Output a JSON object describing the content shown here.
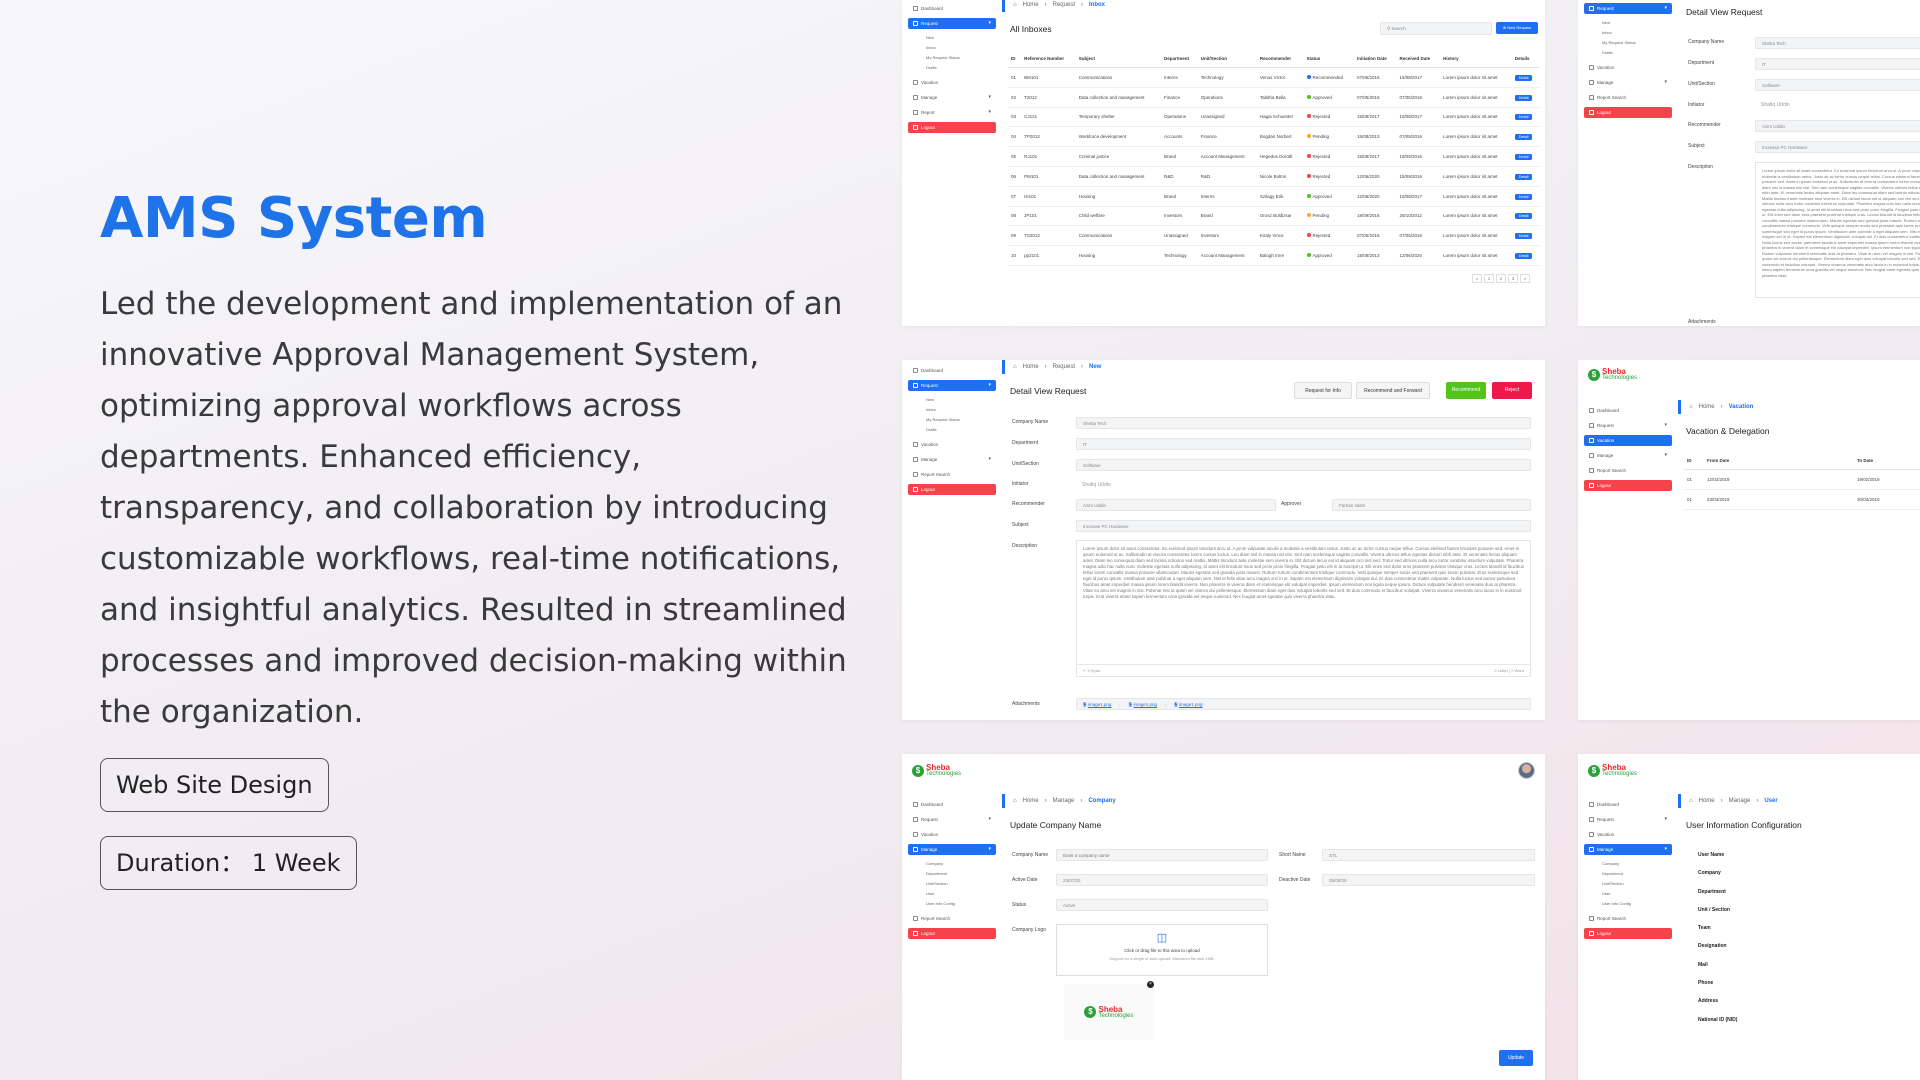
{
  "hero": {
    "title": "AMS System",
    "description": "Led the development and implementation of an innovative Approval Management System, optimizing approval workflows across departments. Enhanced efficiency, transparency, and collaboration by introducing customizable workflows, real-time notifications, and insightful analytics. Resulted in streamlined processes and improved decision-making within the organization.",
    "tag1": "Web Site Design",
    "tag2": "Duration： 1 Week"
  },
  "brand": {
    "logo_letter": "$",
    "line1": "Sheba",
    "line2": "Technologies",
    "green": "#2aa23a",
    "red": "#e62b2b"
  },
  "colors": {
    "accent": "#1e73e8",
    "primary": "#1e6ff1",
    "danger": "#f5424b",
    "success": "#52c41a"
  },
  "sidebar": {
    "dashboard": "Dashboard",
    "request": "Request",
    "vacation": "Vacation",
    "manage": "Manage",
    "report": "Report",
    "report_search": "Report Search",
    "logout": "Logout",
    "request_sub": [
      "New",
      "Inbox",
      "My Request Status",
      "Drafts"
    ],
    "manage_sub": [
      "Company",
      "Department",
      "Unit/Section",
      "User",
      "User Info Config"
    ]
  },
  "crumbs": {
    "home": "Home",
    "request": "Request",
    "manage": "Manage",
    "inbox": "Inbox",
    "new": "New",
    "vacation": "Vacation",
    "company": "Company",
    "user": "User"
  },
  "inbox": {
    "title": "All Inboxes",
    "search_placeholder": "Search",
    "new_request": "New Request",
    "headers": [
      "ID",
      "Reference Number",
      "Subject",
      "Department",
      "Unit/Section",
      "Recommender",
      "Status",
      "Initiation Date",
      "Received Date",
      "History",
      "Details"
    ],
    "rows": [
      {
        "id": "01",
        "ref": "BM101",
        "subject": "Communications",
        "dept": "Interns",
        "unit": "Technology",
        "rec": "Venus Victor",
        "status": "Recommended",
        "sc": "#1e6ff1",
        "init": "07/05/2016",
        "recv": "15/08/2017",
        "hist": "Lorem ipsum dolor sit amet",
        "btn": "Detail"
      },
      {
        "id": "02",
        "ref": "T2012",
        "subject": "Data collection and management",
        "dept": "Finance",
        "unit": "Operations",
        "rec": "Tabitha Bella",
        "status": "Approved",
        "sc": "#52c41a",
        "init": "07/05/2016",
        "recv": "07/05/2016",
        "hist": "Lorem ipsum dolor sit amet",
        "btn": "Detail"
      },
      {
        "id": "03",
        "ref": "CJ121",
        "subject": "Temporary shelter",
        "dept": "Operations",
        "unit": "Unassigned",
        "rec": "Hagai Schuester",
        "status": "Rejected",
        "sc": "#f5424b",
        "init": "15/08/2017",
        "recv": "15/08/2017",
        "hist": "Lorem ipsum dolor sit amet",
        "btn": "Detail"
      },
      {
        "id": "04",
        "ref": "TP2012",
        "subject": "Workforce development",
        "dept": "Accounts",
        "unit": "Finance",
        "rec": "Bogdan Norbert",
        "status": "Pending",
        "sc": "#faad14",
        "init": "15/08/2013",
        "recv": "07/05/2016",
        "hist": "Lorem ipsum dolor sit amet",
        "btn": "Detail"
      },
      {
        "id": "05",
        "ref": "RJ101",
        "subject": "Criminal justice",
        "dept": "Brand",
        "unit": "Account Management",
        "rec": "Hegedus Dorottl",
        "status": "Rejected",
        "sc": "#f5424b",
        "init": "15/08/2017",
        "recv": "18/09/2016",
        "hist": "Lorem ipsum dolor sit amet",
        "btn": "Detail"
      },
      {
        "id": "06",
        "ref": "PM101",
        "subject": "Data collection and management",
        "dept": "R&D",
        "unit": "R&D",
        "rec": "Nicole Bolton",
        "status": "Rejected",
        "sc": "#f5424b",
        "init": "12/06/2020",
        "recv": "18/09/2016",
        "hist": "Lorem ipsum dolor sit amet",
        "btn": "Detail"
      },
      {
        "id": "07",
        "ref": "HI101",
        "subject": "Housing",
        "dept": "Brand",
        "unit": "Interns",
        "rec": "Szilagy Erik",
        "status": "Approved",
        "sc": "#52c41a",
        "init": "12/06/2020",
        "recv": "15/08/2017",
        "hist": "Lorem ipsum dolor sit amet",
        "btn": "Detail"
      },
      {
        "id": "08",
        "ref": "JP101",
        "subject": "Child welfare",
        "dept": "Investors",
        "unit": "Brand",
        "rec": "Orosz Boldizsar",
        "status": "Pending",
        "sc": "#faad14",
        "init": "18/09/2016",
        "recv": "28/10/2012",
        "hist": "Lorem ipsum dolor sit amet",
        "btn": "Detail"
      },
      {
        "id": "09",
        "ref": "TS2012",
        "subject": "Communications",
        "dept": "Unassigned",
        "unit": "Investors",
        "rec": "Kiraly Vince",
        "status": "Rejected",
        "sc": "#f5424b",
        "init": "07/05/2016",
        "recv": "07/05/2016",
        "hist": "Lorem ipsum dolor sit amet",
        "btn": "Detail"
      },
      {
        "id": "10",
        "ref": "pp2101",
        "subject": "Housing",
        "dept": "Technology",
        "unit": "Account Management",
        "rec": "Balogh Imre",
        "status": "Approved",
        "sc": "#52c41a",
        "init": "15/08/2013",
        "recv": "12/06/2020",
        "hist": "Lorem ipsum dolor sit amet",
        "btn": "Detail"
      }
    ],
    "pages": [
      "<",
      "1",
      "2",
      "3",
      ">"
    ]
  },
  "detail": {
    "title": "Detail View Request",
    "buttons": {
      "info": "Request for Info",
      "forward": "Recommend and Forward",
      "recommend": "Recommend",
      "reject": "Reject"
    },
    "labels": {
      "company": "Company Name",
      "dept": "Department",
      "unit": "Unit/Section",
      "initiator": "Initiator",
      "recommender": "Recommender",
      "approver": "Approver",
      "subject": "Subject",
      "description": "Description",
      "attachments": "Attachments"
    },
    "values": {
      "company": "Sheba Tech",
      "dept": "IT",
      "unit": "Software",
      "initiator": "Shafiq Uddin",
      "recommender": "Azim Uddin",
      "approver": "Farhan Islam",
      "subject": "Increase PC Hardware"
    },
    "description": "Lorem ipsum dolor sit amet consectetur. Eu euismod ipsum tincidunt arcu ut. A proin vulputate iaculis a molestie a vestibulum netus. Justo ac ac tortor cursus neque tellus. Cursus eleifend fames tincidunt posuere sed. Amet in ipsum euismod ut ac. Sollicitudin at viverra consectetur lorem cursus luctus. Leo diam nisl in massa nisl nisl. Sed nam scelerisque sagittis convallis. Viverra ultrices tellus egestas dictum nibh ante. Et venenatis lectus aliquam amet. Diam leo consequat diam sed lacinia ridiculus sed mattis. Mattis tincidunt ante molestie sem viverra in. Elit dictum lacus est id aliquam orci nisl sed. Tortor sed ultrices nulla arcu tortor curabitur interdum vulputate. Pharetra magna odio hac nulla nunc molestie egestas nulla adipiscing. Id amet elit tincidunt risus sed proin proin fringilla. Feugiat justo elit in at suscipit ut. Elit enim sed dolor eros praesent pulvinar tristique cras. Lectus blandit id faucibus tellus lorem convallis massa posuere ullamcorper. Mauris egestas sed gravida justo mauris. Rutrum rutrum condimentum tristique commodo. Velit quisque semper sociis sed praesent quis lorem pulvinar. Eros scelerisque sed eget id purus ipsum. Vestibulum ante pulvinar a eget aliquam sem. Nisl et felis vitae arcu magna orci in ut. Sapien est elementum dignissim volutpat dui. Et duis consectetur mattis vulputate. Nulla luctus sed auctor parturient faucibus amet imperdiet massa ipsum lorem blandit viverra. Nun pharetra in viverra diam et scelerisque elit volutpat imperdiet. Ipsum elementum non ligula neque ipsum. Dictum vulputate hendrerit venenatis duis at pharetra. Vitae eu arcu vel magnis in nisi. Pulvinar nisi ut quam vel viverra dui pellentesque. Elementum diam eget duis volutpat lobortis sed sed. Et duis commodo et faucibus volutpat. Viverra vivamus venenatis arcu lacus in in euismod turpis. Erat viverra etiam sapien fermentum urna gravida vel neque euismod. Nec feugiat amet egestas quis viverra pharetra vitae.",
    "span_note": "↵ 4 Span",
    "counter": "2 Letter | 2 Word",
    "attachments": [
      "image1.png",
      "image1.png",
      "image1.png"
    ]
  },
  "vacation": {
    "title": "Vacation & Delegation",
    "headers": [
      "ID",
      "From Date",
      "To Date"
    ],
    "rows": [
      [
        "01",
        "12/02/2019",
        "19/02/2019"
      ],
      [
        "01",
        "23/03/2019",
        "30/04/2019"
      ]
    ]
  },
  "company": {
    "title": "Update Company Name",
    "labels": {
      "name": "Company Name",
      "short": "Short Name",
      "active": "Active Date",
      "deactive": "Deactive Date",
      "status": "Status",
      "logo": "Company Logo"
    },
    "placeholders": {
      "name": "Enter a company name"
    },
    "values": {
      "short": "STL",
      "active": "23/07/23",
      "deactive": "05/08/25",
      "status": "Active"
    },
    "upload_main": "Click or drag file to this area to upload",
    "upload_sub": "Support for a single or bulk upload. Maximum file size 2MB.",
    "remove": "×",
    "update": "Update"
  },
  "user_config": {
    "title": "User Information Configuration",
    "fields": [
      "User Name",
      "Company",
      "Department",
      "Unit / Section",
      "Team",
      "Designation",
      "Mail",
      "Phone",
      "Address",
      "National ID (NID)"
    ]
  }
}
